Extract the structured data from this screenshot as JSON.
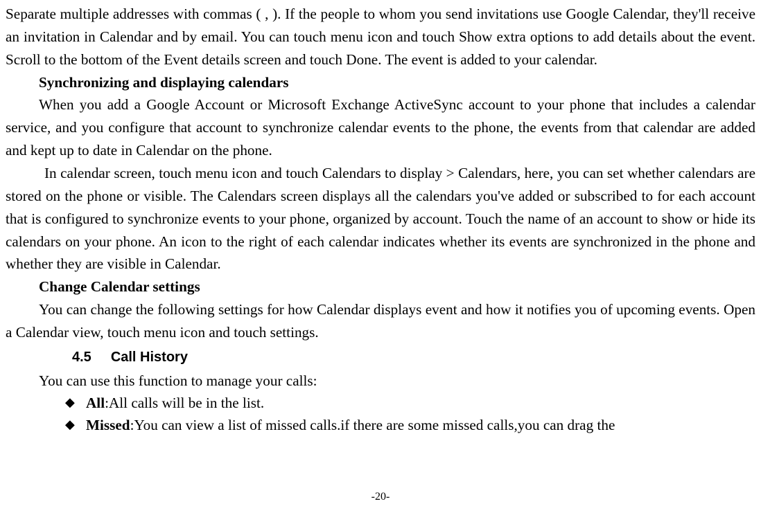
{
  "intro": {
    "p1": "Separate multiple addresses with commas ( , ). If the people to whom you send invitations use Google Calendar, they'll receive an invitation in Calendar and by email. You can touch menu icon and touch Show extra options to add details about the event. Scroll to the bottom of the Event details screen and touch Done. The event is added to your calendar."
  },
  "sync": {
    "heading": "Synchronizing and displaying calendars",
    "p1": "When you add a Google Account or Microsoft Exchange ActiveSync account to your phone that includes a calendar service, and you configure that account to synchronize calendar events to the phone, the events from that calendar are added and kept up to date in Calendar on the phone.",
    "p2": "In calendar screen, touch menu icon and touch Calendars to display > Calendars, here, you can set whether calendars are stored on the phone or visible. The Calendars screen displays all the calendars you've added or subscribed to for each account that is configured to synchronize events to your phone, organized by account. Touch the name of an account to show or hide its calendars on your phone. An icon to the right of each calendar indicates whether its events are synchronized in the phone and whether they are visible in Calendar."
  },
  "changeSettings": {
    "heading": "Change Calendar settings",
    "p1": "You can change the following settings for how Calendar displays event and how it notifies you of upcoming events. Open a Calendar view, touch menu icon and touch settings."
  },
  "section": {
    "number": "4.5",
    "title": "Call History"
  },
  "calls": {
    "intro": "You can use this function to manage your calls:",
    "items": [
      {
        "label": "All",
        "text": ":All calls will be in the list."
      },
      {
        "label": "Missed",
        "text": ":You can view a list of missed calls.if there are some missed calls,you can drag the"
      }
    ]
  },
  "pageNumber": "-20-"
}
